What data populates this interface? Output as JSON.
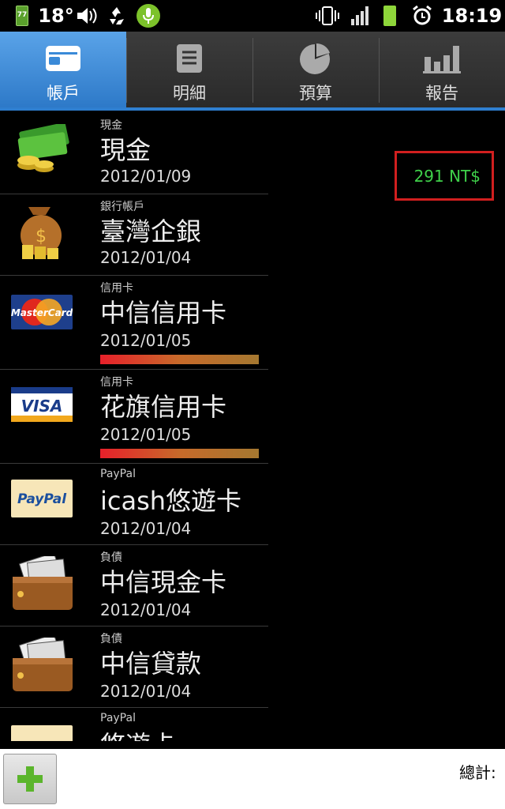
{
  "status_bar": {
    "battery_small_level": "77",
    "temperature": "18°",
    "time": "18:19",
    "icons": [
      "battery-icon",
      "volume-icon",
      "recycle-icon",
      "microphone-icon",
      "vibrate-icon",
      "signal-icon",
      "battery-icon",
      "alarm-icon"
    ]
  },
  "tabs": [
    {
      "label": "帳戶",
      "icon": "wallet-icon",
      "active": true
    },
    {
      "label": "明細",
      "icon": "list-icon",
      "active": false
    },
    {
      "label": "預算",
      "icon": "pie-chart-icon",
      "active": false
    },
    {
      "label": "報告",
      "icon": "bar-chart-icon",
      "active": false
    }
  ],
  "accounts": [
    {
      "type": "現金",
      "name": "現金",
      "date": "2012/01/09",
      "icon": "cash-icon",
      "amount": "291 NT$"
    },
    {
      "type": "銀行帳戶",
      "name": "臺灣企銀",
      "date": "2012/01/04",
      "icon": "money-bag-icon"
    },
    {
      "type": "信用卡",
      "name": "中信信用卡",
      "date": "2012/01/05",
      "icon": "mastercard-icon",
      "card_label": "MasterCard",
      "has_bar": true
    },
    {
      "type": "信用卡",
      "name": "花旗信用卡",
      "date": "2012/01/05",
      "icon": "visa-icon",
      "card_label": "VISA",
      "has_bar": true
    },
    {
      "type": "PayPal",
      "name": "icash悠遊卡",
      "date": "2012/01/04",
      "icon": "paypal-icon",
      "card_label": "PayPal"
    },
    {
      "type": "負債",
      "name": "中信現金卡",
      "date": "2012/01/04",
      "icon": "wallet-cards-icon"
    },
    {
      "type": "負債",
      "name": "中信貸款",
      "date": "2012/01/04",
      "icon": "wallet-cards-icon"
    },
    {
      "type": "PayPal",
      "name": "悠遊卡",
      "date": "",
      "icon": "paypal-icon"
    }
  ],
  "bottom": {
    "total_label": "總計:",
    "add_icon": "plus-icon"
  },
  "colors": {
    "accent": "#2f7fd0",
    "amount": "#3fd04a",
    "highlight": "#d11f1f"
  }
}
